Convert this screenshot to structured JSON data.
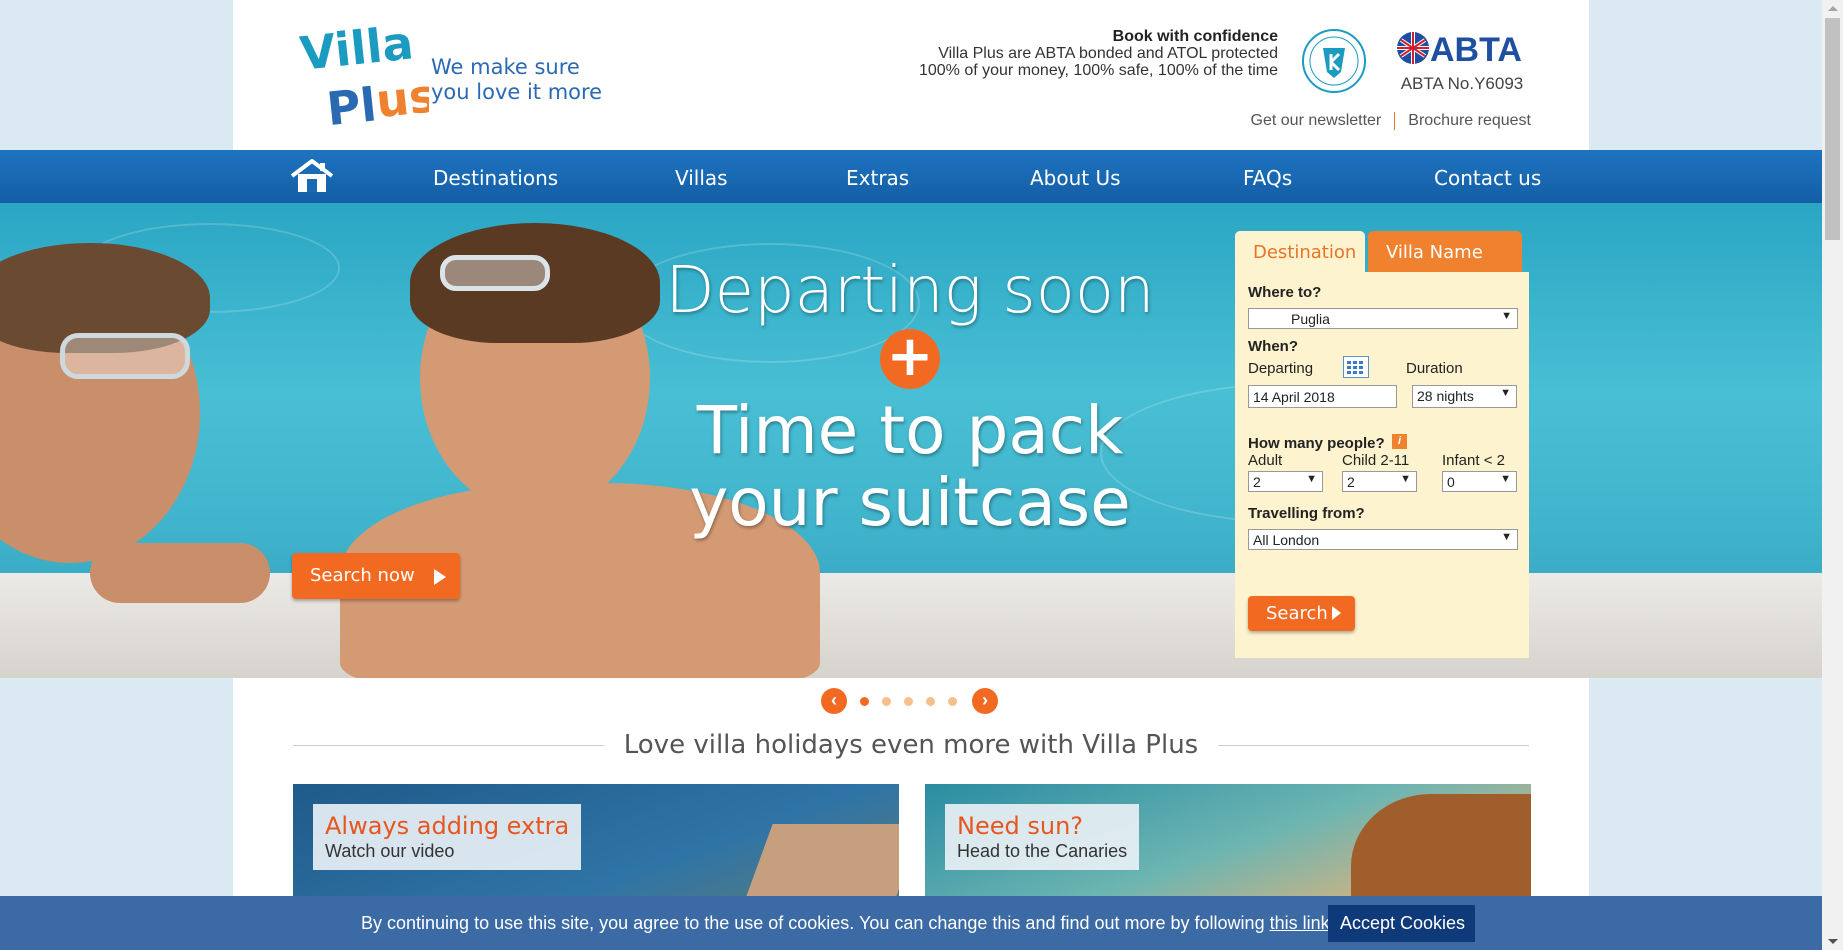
{
  "header": {
    "tagline": [
      "We make sure",
      "you love it more"
    ],
    "confidence_title": "Book with confidence",
    "confidence_lines": [
      "Villa Plus are ABTA bonded and ATOL protected",
      "100% of your money, 100% safe, 100% of the time"
    ],
    "abta_number": "ABTA No.Y6093",
    "links": [
      "Get our newsletter",
      "Brochure request"
    ]
  },
  "nav": {
    "items": [
      "Destinations",
      "Villas",
      "Extras",
      "About Us",
      "FAQs",
      "Contact us"
    ]
  },
  "hero": {
    "line1": "Departing soon",
    "line2a": "Time to pack",
    "line2b": "your suitcase",
    "cta": "Search now"
  },
  "search": {
    "tabs": [
      "Destination",
      "Villa Name"
    ],
    "where_label": "Where to?",
    "where_value": "Puglia",
    "when_label": "When?",
    "departing_label": "Departing",
    "duration_label": "Duration",
    "date_value": "14 April 2018",
    "duration_value": "28 nights",
    "people_label": "How many people?",
    "adult_label": "Adult",
    "child_label": "Child 2-11",
    "infant_label": "Infant < 2",
    "adult_value": "2",
    "child_value": "2",
    "infant_value": "0",
    "from_label": "Travelling from?",
    "from_value": "All London",
    "button": "Search"
  },
  "section": {
    "title": "Love villa holidays even more with Villa Plus",
    "cards": [
      {
        "title": "Always adding extra",
        "subtitle": "Watch our video"
      },
      {
        "title": "Need sun?",
        "subtitle": "Head to the Canaries"
      }
    ]
  },
  "cookie": {
    "text_before": "By continuing to use this site, you agree to the use of cookies. You can change this and find out more by following ",
    "link": "this link",
    "text_after": ".",
    "accept": "Accept Cookies"
  },
  "colors": {
    "brand_blue": "#1e73bf",
    "accent_orange": "#f26a21",
    "panel_bg": "#fdf3cf"
  }
}
